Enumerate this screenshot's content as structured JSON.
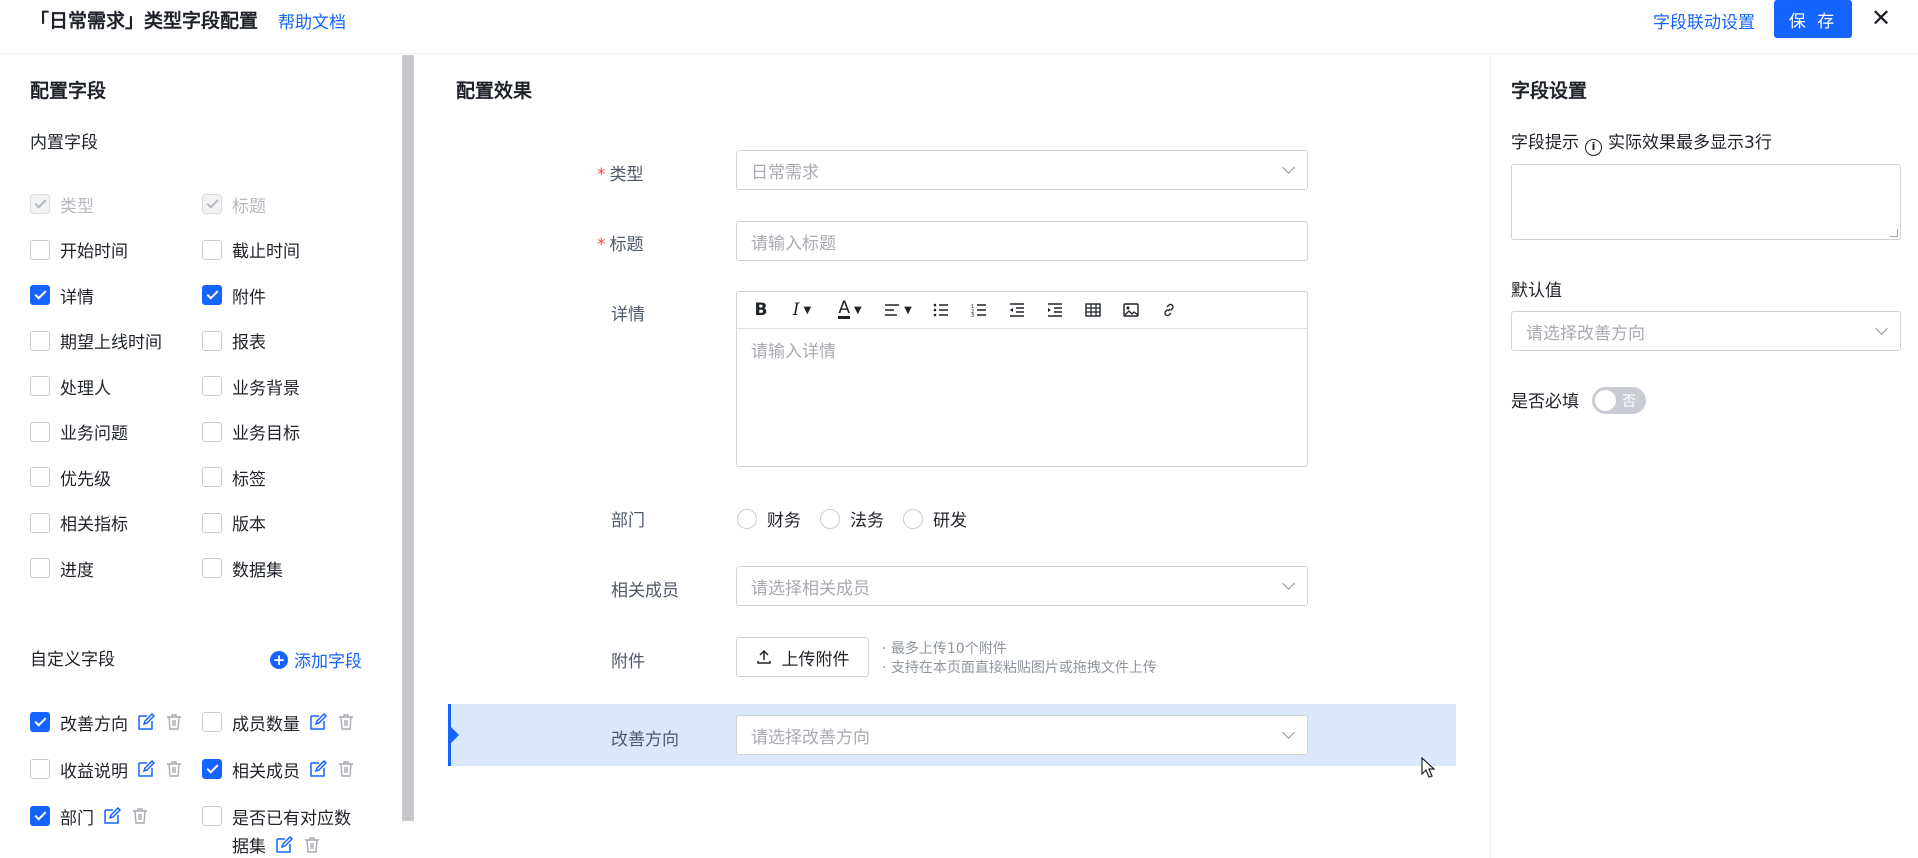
{
  "header": {
    "title": "「日常需求」类型字段配置",
    "help_link": "帮助文档",
    "linkage_link": "字段联动设置",
    "save_label": "保 存",
    "close_label": "✕"
  },
  "left": {
    "title": "配置字段",
    "builtin_title": "内置字段",
    "builtin_fields": [
      {
        "label": "类型",
        "state": "disabled-checked"
      },
      {
        "label": "标题",
        "state": "disabled-checked"
      },
      {
        "label": "开始时间",
        "state": "unchecked"
      },
      {
        "label": "截止时间",
        "state": "unchecked"
      },
      {
        "label": "详情",
        "state": "checked"
      },
      {
        "label": "附件",
        "state": "checked"
      },
      {
        "label": "期望上线时间",
        "state": "unchecked"
      },
      {
        "label": "报表",
        "state": "unchecked"
      },
      {
        "label": "处理人",
        "state": "unchecked"
      },
      {
        "label": "业务背景",
        "state": "unchecked"
      },
      {
        "label": "业务问题",
        "state": "unchecked"
      },
      {
        "label": "业务目标",
        "state": "unchecked"
      },
      {
        "label": "优先级",
        "state": "unchecked"
      },
      {
        "label": "标签",
        "state": "unchecked"
      },
      {
        "label": "相关指标",
        "state": "unchecked"
      },
      {
        "label": "版本",
        "state": "unchecked"
      },
      {
        "label": "进度",
        "state": "unchecked"
      },
      {
        "label": "数据集",
        "state": "unchecked"
      }
    ],
    "custom_title": "自定义字段",
    "add_field": "添加字段",
    "custom_fields": [
      {
        "label": "改善方向",
        "state": "checked"
      },
      {
        "label": "成员数量",
        "state": "unchecked"
      },
      {
        "label": "收益说明",
        "state": "unchecked"
      },
      {
        "label": "相关成员",
        "state": "checked"
      },
      {
        "label": "部门",
        "state": "checked"
      },
      {
        "label": "是否已有对应数",
        "label2": "据集",
        "state": "unchecked"
      }
    ]
  },
  "middle": {
    "title": "配置效果",
    "type_label": "类型",
    "type_value": "日常需求",
    "title_label": "标题",
    "title_placeholder": "请输入标题",
    "detail_label": "详情",
    "detail_placeholder": "请输入详情",
    "dept_label": "部门",
    "dept_options": [
      "财务",
      "法务",
      "研发"
    ],
    "members_label": "相关成员",
    "members_placeholder": "请选择相关成员",
    "attach_label": "附件",
    "upload_label": "上传附件",
    "attach_hints": [
      "· 最多上传10个附件",
      "· 支持在本页面直接粘贴图片或拖拽文件上传"
    ],
    "improve_label": "改善方向",
    "improve_placeholder": "请选择改善方向",
    "required_mark": "*"
  },
  "right": {
    "title": "字段设置",
    "hint_label": "字段提示",
    "hint_note": "实际效果最多显示3行",
    "default_label": "默认值",
    "default_placeholder": "请选择改善方向",
    "required_label": "是否必填",
    "switch_label": "否"
  },
  "colors": {
    "accent": "#1664ff",
    "highlight": "#dbe8fb",
    "required": "#f54a45"
  }
}
